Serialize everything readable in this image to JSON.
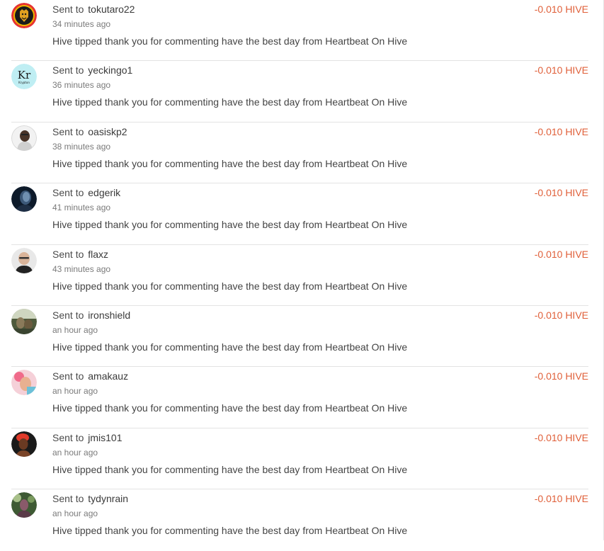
{
  "transfers": [
    {
      "prefix": "Sent to",
      "username": "tokutaro22",
      "time": "34 minutes ago",
      "memo": "Hive tipped thank you for commenting have the best day from Heartbeat On Hive",
      "amount": "-0.010 HIVE",
      "avatar_icon": "lion-crest-avatar",
      "avatar_colors": [
        "#e63232",
        "#1a1a1a",
        "#f0b400"
      ]
    },
    {
      "prefix": "Sent to",
      "username": "yeckingo1",
      "time": "36 minutes ago",
      "memo": "Hive tipped thank you for commenting have the best day from Heartbeat On Hive",
      "amount": "-0.010 HIVE",
      "avatar_icon": "kr-element-avatar",
      "avatar_colors": [
        "#bfeef3",
        "#1a1a1a"
      ]
    },
    {
      "prefix": "Sent to",
      "username": "oasiskp2",
      "time": "38 minutes ago",
      "memo": "Hive tipped thank you for commenting have the best day from Heartbeat On Hive",
      "amount": "-0.010 HIVE",
      "avatar_icon": "person-photo-avatar",
      "avatar_colors": [
        "#f2f2f2",
        "#4a3428",
        "#cfcfcf"
      ]
    },
    {
      "prefix": "Sent to",
      "username": "edgerik",
      "time": "41 minutes ago",
      "memo": "Hive tipped thank you for commenting have the best day from Heartbeat On Hive",
      "amount": "-0.010 HIVE",
      "avatar_icon": "dark-portrait-avatar",
      "avatar_colors": [
        "#0d1a2a",
        "#6f8fb0"
      ]
    },
    {
      "prefix": "Sent to",
      "username": "flaxz",
      "time": "43 minutes ago",
      "memo": "Hive tipped thank you for commenting have the best day from Heartbeat On Hive",
      "amount": "-0.010 HIVE",
      "avatar_icon": "bald-man-avatar",
      "avatar_colors": [
        "#e8e8e8",
        "#d9b49a",
        "#222222"
      ]
    },
    {
      "prefix": "Sent to",
      "username": "ironshield",
      "time": "an hour ago",
      "memo": "Hive tipped thank you for commenting have the best day from Heartbeat On Hive",
      "amount": "-0.010 HIVE",
      "avatar_icon": "outdoor-photo-avatar",
      "avatar_colors": [
        "#4e5a3c",
        "#8a7a5a",
        "#cfd6c0"
      ]
    },
    {
      "prefix": "Sent to",
      "username": "amakauz",
      "time": "an hour ago",
      "memo": "Hive tipped thank you for commenting have the best day from Heartbeat On Hive",
      "amount": "-0.010 HIVE",
      "avatar_icon": "pink-flower-avatar",
      "avatar_colors": [
        "#f06a8a",
        "#e8b090",
        "#6cc0d8"
      ]
    },
    {
      "prefix": "Sent to",
      "username": "jmis101",
      "time": "an hour ago",
      "memo": "Hive tipped thank you for commenting have the best day from Heartbeat On Hive",
      "amount": "-0.010 HIVE",
      "avatar_icon": "woman-red-hair-avatar",
      "avatar_colors": [
        "#1a1a1a",
        "#e03a2a",
        "#6a3a22"
      ]
    },
    {
      "prefix": "Sent to",
      "username": "tydynrain",
      "time": "an hour ago",
      "memo": "Hive tipped thank you for commenting have the best day from Heartbeat On Hive",
      "amount": "-0.010 HIVE",
      "avatar_icon": "forest-portrait-avatar",
      "avatar_colors": [
        "#3e5a34",
        "#8a5a6a",
        "#a8c08a"
      ]
    }
  ],
  "colors": {
    "amount": "#e0603a",
    "divider": "#e3e3e3",
    "text": "#333333",
    "muted": "#7a7a7a"
  }
}
